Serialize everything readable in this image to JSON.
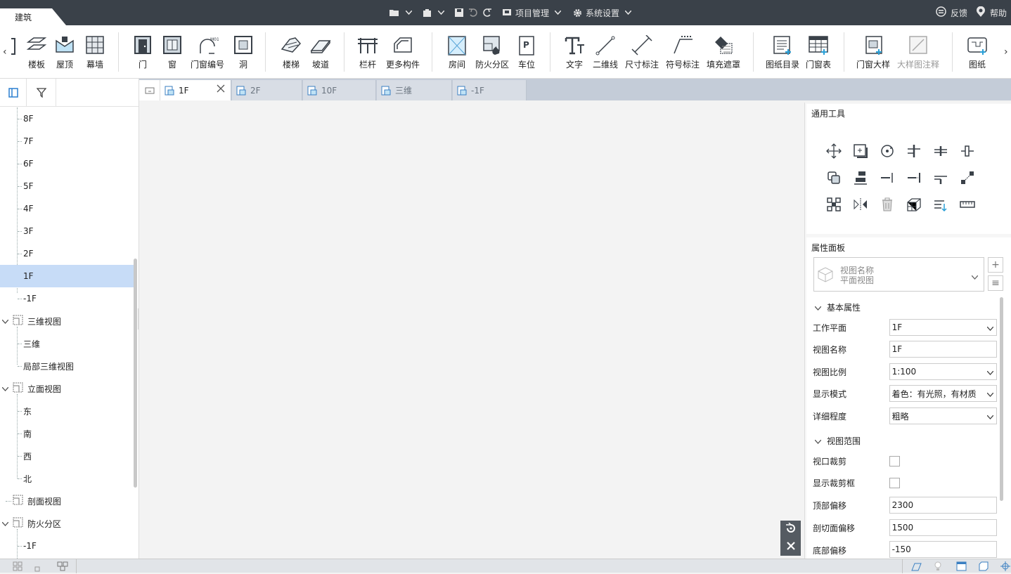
{
  "titlebar": {
    "app_tab": "建筑",
    "project_menu": "项目管理",
    "settings_menu": "系统设置",
    "feedback": "反馈",
    "help": "帮助"
  },
  "ribbon": {
    "items": [
      {
        "label": "楼板",
        "icon": "slab-icon"
      },
      {
        "label": "屋顶",
        "icon": "roof-icon"
      },
      {
        "label": "幕墙",
        "icon": "curtain-wall-icon"
      },
      {
        "label": "门",
        "icon": "door-icon"
      },
      {
        "label": "窗",
        "icon": "window-icon"
      },
      {
        "label": "门窗编号",
        "icon": "door-window-number-icon"
      },
      {
        "label": "洞",
        "icon": "opening-icon"
      },
      {
        "label": "楼梯",
        "icon": "stair-icon"
      },
      {
        "label": "坡道",
        "icon": "ramp-icon"
      },
      {
        "label": "栏杆",
        "icon": "railing-icon"
      },
      {
        "label": "更多构件",
        "icon": "more-components-icon"
      },
      {
        "label": "房间",
        "icon": "room-icon"
      },
      {
        "label": "防火分区",
        "icon": "fire-zone-icon"
      },
      {
        "label": "车位",
        "icon": "parking-icon"
      },
      {
        "label": "文字",
        "icon": "text-icon"
      },
      {
        "label": "二维线",
        "icon": "line-2d-icon"
      },
      {
        "label": "尺寸标注",
        "icon": "dimension-icon"
      },
      {
        "label": "符号标注",
        "icon": "symbol-annotation-icon"
      },
      {
        "label": "填充遮罩",
        "icon": "fill-mask-icon"
      },
      {
        "label": "图纸目录",
        "icon": "drawing-catalog-icon"
      },
      {
        "label": "门窗表",
        "icon": "door-window-table-icon"
      },
      {
        "label": "门窗大样",
        "icon": "door-window-detail-icon"
      },
      {
        "label": "大样图注释",
        "icon": "detail-annotation-icon",
        "disabled": true
      },
      {
        "label": "图纸",
        "icon": "drawing-icon"
      }
    ]
  },
  "tree": {
    "items": [
      "8F",
      "7F",
      "6F",
      "5F",
      "4F",
      "3F",
      "2F",
      "1F",
      "-1F",
      "三维视图",
      "三维",
      "局部三维视图",
      "立面视图",
      "东",
      "南",
      "西",
      "北",
      "剖面视图",
      "防火分区",
      "-1F"
    ],
    "selected": "1F"
  },
  "tabs": [
    {
      "label": "1F",
      "active": true
    },
    {
      "label": "2F"
    },
    {
      "label": "10F"
    },
    {
      "label": "三维"
    },
    {
      "label": "-1F"
    }
  ],
  "tools_panel": {
    "title": "通用工具"
  },
  "props": {
    "title": "属性面板",
    "view_type_name": "视图名称",
    "view_type_value": "平面视图",
    "section_basic": "基本属性",
    "section_range": "视图范围",
    "rows": [
      {
        "key": "工作平面",
        "value": "1F"
      },
      {
        "key": "视图名称",
        "value": "1F"
      },
      {
        "key": "视图比例",
        "value": "1:100"
      },
      {
        "key": "显示模式",
        "value": "着色：有光照，有材质"
      },
      {
        "key": "详细程度",
        "value": "粗略"
      },
      {
        "key": "视口裁剪",
        "value": ""
      },
      {
        "key": "显示裁剪框",
        "value": ""
      },
      {
        "key": "顶部偏移",
        "value": "2300"
      },
      {
        "key": "剖切面偏移",
        "value": "1500"
      },
      {
        "key": "底部偏移",
        "value": "-150"
      }
    ]
  }
}
